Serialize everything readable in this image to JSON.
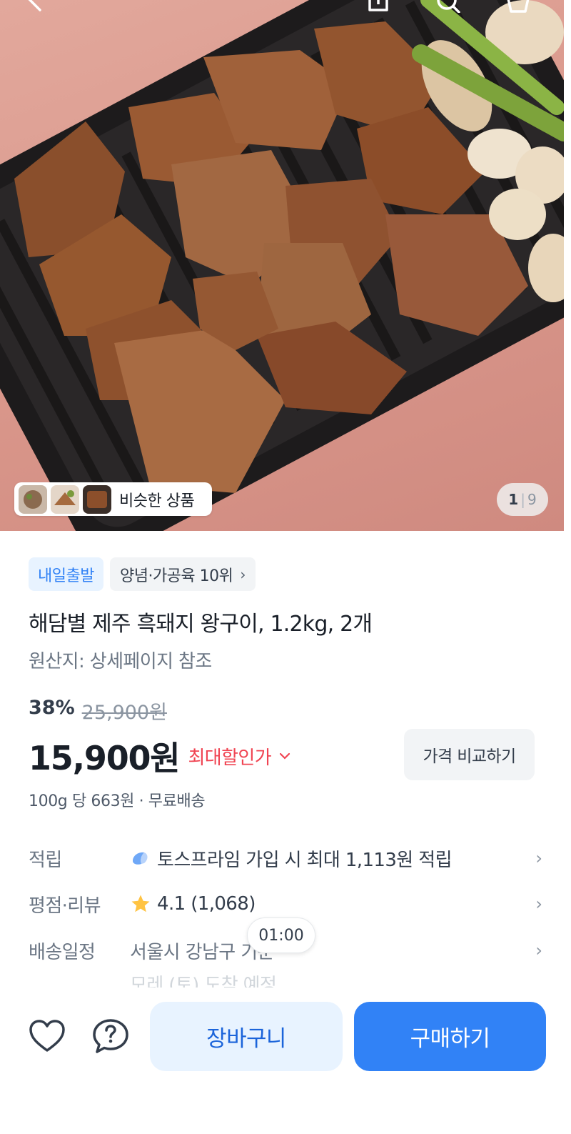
{
  "hero": {
    "similar_label": "비슷한 상품",
    "page_current": "1",
    "page_total": "9"
  },
  "tags": {
    "delivery_badge": "내일출발",
    "rank_badge": "양념·가공육 10위"
  },
  "product": {
    "title": "해담별 제주 흑돼지 왕구이, 1.2kg, 2개",
    "origin": "원산지: 상세페이지 참조"
  },
  "price": {
    "discount_rate": "38%",
    "original_price": "25,900원",
    "sale_price": "15,900원",
    "max_discount_label": "최대할인가",
    "compare_button": "가격 비교하기",
    "unit_info": "100g 당 663원 · 무료배송"
  },
  "info": {
    "points_label": "적립",
    "points_value": "토스프라임 가입 시 최대 1,113원 적립",
    "rating_label": "평점·리뷰",
    "rating_value": "4.1 (1,068)",
    "shipping_label": "배송일정",
    "shipping_value": "서울시 강남구 기준",
    "shipping_eta": "모레 (토) 도착 예정"
  },
  "timer": "01:00",
  "actions": {
    "cart_label": "장바구니",
    "buy_label": "구매하기"
  },
  "colors": {
    "accent": "#3182f6",
    "accent_light": "#e8f3ff",
    "discount_red": "#f04452",
    "star": "#ffc342"
  },
  "icons": [
    "back-icon",
    "share-icon",
    "search-icon",
    "cart-icon",
    "heart-icon",
    "question-icon",
    "star-icon",
    "chevron-right-icon",
    "chevron-down-icon",
    "toss-prime-icon"
  ]
}
